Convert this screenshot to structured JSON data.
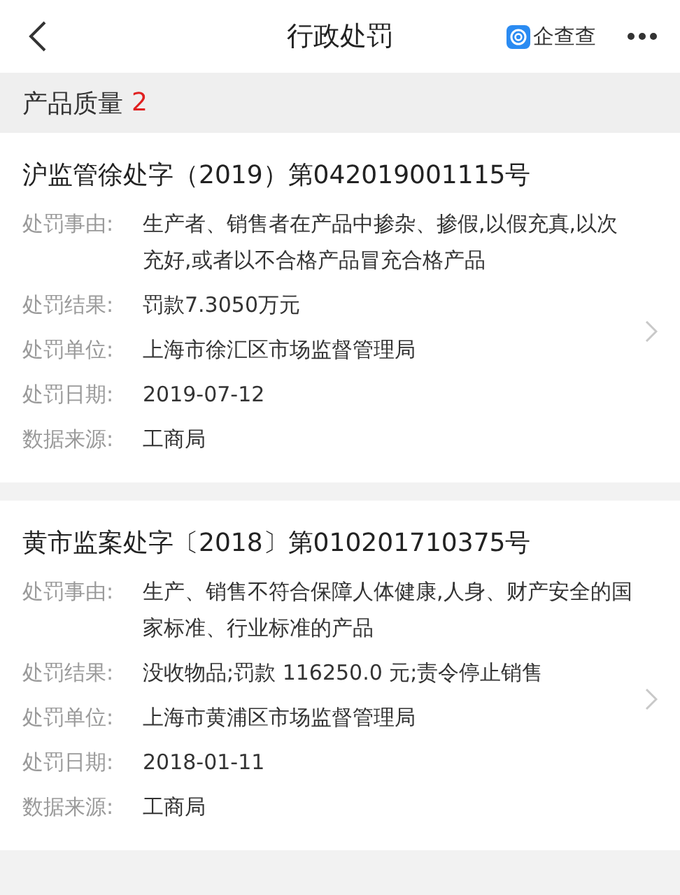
{
  "nav": {
    "title": "行政处罚",
    "brand": "企查查"
  },
  "section": {
    "title": "产品质量",
    "count": "2"
  },
  "records": [
    {
      "title": "沪监管徐处字（2019）第042019001115号",
      "fields": [
        {
          "label": "处罚事由:",
          "value": "生产者、销售者在产品中掺杂、掺假,以假充真,以次充好,或者以不合格产品冒充合格产品"
        },
        {
          "label": "处罚结果:",
          "value": "罚款7.3050万元"
        },
        {
          "label": "处罚单位:",
          "value": "上海市徐汇区市场监督管理局"
        },
        {
          "label": "处罚日期:",
          "value": "2019-07-12"
        },
        {
          "label": "数据来源:",
          "value": "工商局"
        }
      ]
    },
    {
      "title": "黄市监案处字〔2018〕第010201710375号",
      "fields": [
        {
          "label": "处罚事由:",
          "value": "生产、销售不符合保障人体健康,人身、财产安全的国家标准、行业标准的产品"
        },
        {
          "label": "处罚结果:",
          "value": "没收物品;罚款 116250.0 元;责令停止销售"
        },
        {
          "label": "处罚单位:",
          "value": "上海市黄浦区市场监督管理局"
        },
        {
          "label": "处罚日期:",
          "value": "2018-01-11"
        },
        {
          "label": "数据来源:",
          "value": "工商局"
        }
      ]
    }
  ]
}
